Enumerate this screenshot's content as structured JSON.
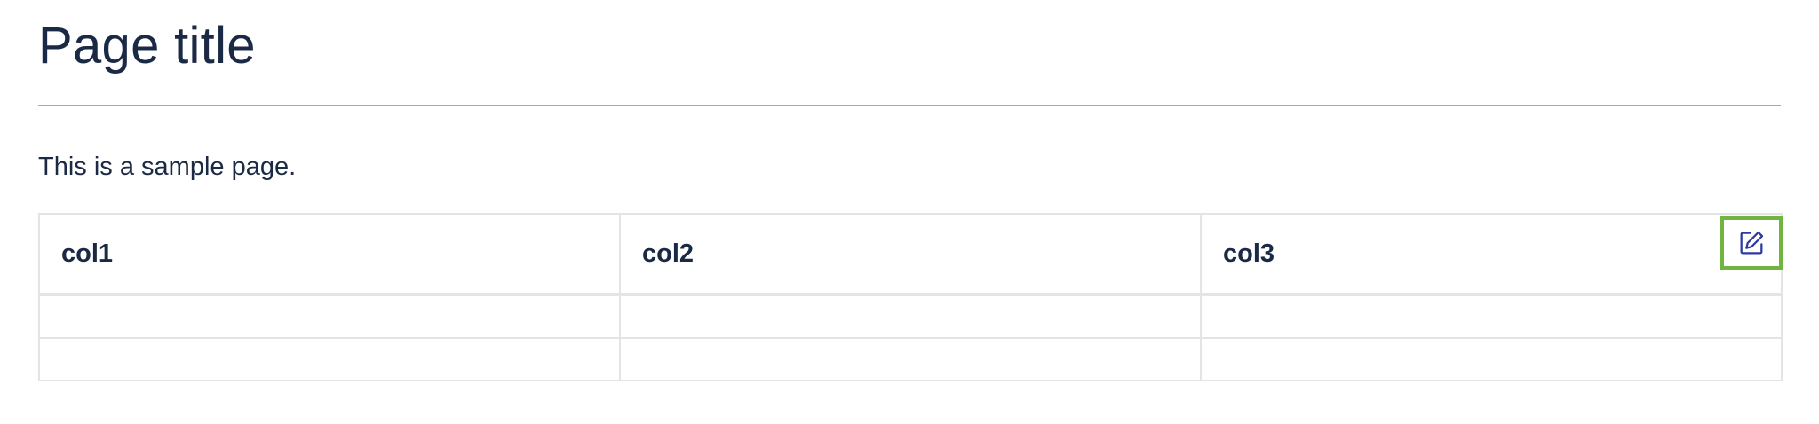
{
  "page": {
    "title": "Page title",
    "intro": "This is a sample page."
  },
  "table": {
    "columns": [
      "col1",
      "col2",
      "col3"
    ],
    "rows": [
      [
        "",
        "",
        ""
      ],
      [
        "",
        "",
        ""
      ]
    ]
  },
  "edit_button": {
    "icon": "edit-icon",
    "border_color": "#72b442",
    "icon_color": "#2d3a9e"
  },
  "colors": {
    "text": "#1b2a44",
    "divider": "#a5a9b0",
    "table_border": "#e3e4e6"
  }
}
